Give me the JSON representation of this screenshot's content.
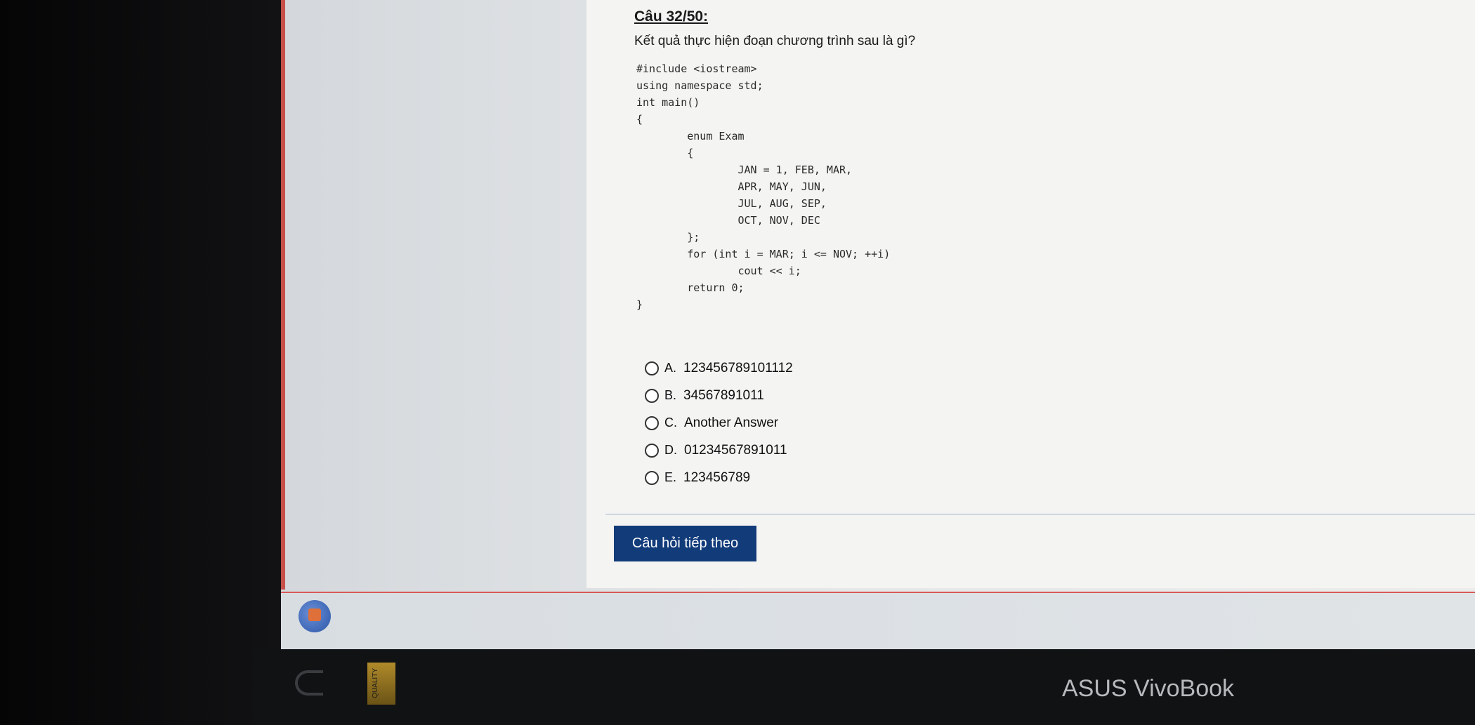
{
  "question": {
    "title": "Câu 32/50:",
    "text": "Kết quả thực hiện đoạn chương trình sau là gì?"
  },
  "code_lines": [
    "#include <iostream>",
    "using namespace std;",
    "int main()",
    "{",
    "        enum Exam",
    "        {",
    "                JAN = 1, FEB, MAR,",
    "                APR, MAY, JUN,",
    "                JUL, AUG, SEP,",
    "                OCT, NOV, DEC",
    "        };",
    "        for (int i = MAR; i <= NOV; ++i)",
    "                cout << i;",
    "        return 0;",
    "}"
  ],
  "answers": [
    {
      "letter": "A.",
      "text": "123456789101112"
    },
    {
      "letter": "B.",
      "text": "34567891011"
    },
    {
      "letter": "C.",
      "text": "Another Answer"
    },
    {
      "letter": "D.",
      "text": "01234567891011"
    },
    {
      "letter": "E.",
      "text": "123456789"
    }
  ],
  "next_button_label": "Câu hỏi tiếp theo",
  "bezel": {
    "brand": "ASUS VivoBook",
    "sticker_text": "QUALITY"
  },
  "colors": {
    "button_bg": "#123b7a",
    "accent_red": "#d85a55"
  },
  "icons": {
    "browser": "browser-icon",
    "radio": "radio-icon"
  }
}
